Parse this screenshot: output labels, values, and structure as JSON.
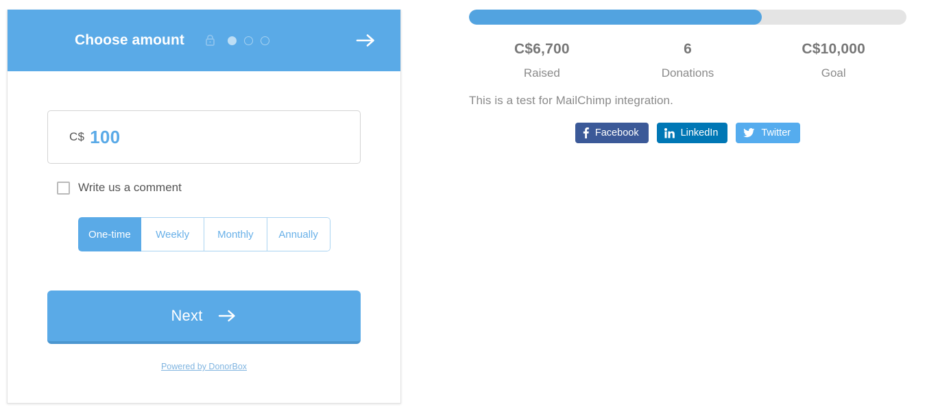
{
  "donation_form": {
    "header": {
      "title": "Choose amount",
      "lock_icon": "lock-icon",
      "next_arrow_icon": "arrow-right-icon",
      "steps": [
        {
          "state": "active"
        },
        {
          "state": "inactive"
        },
        {
          "state": "inactive"
        }
      ]
    },
    "amount": {
      "currency": "C$",
      "value": "100"
    },
    "comment": {
      "label": "Write us a comment",
      "checked": false
    },
    "frequency": {
      "selected": "One-time",
      "options": [
        {
          "label": "One-time",
          "active": true
        },
        {
          "label": "Weekly",
          "active": false
        },
        {
          "label": "Monthly",
          "active": false
        },
        {
          "label": "Annually",
          "active": false
        }
      ]
    },
    "next_button": {
      "label": "Next",
      "icon": "arrow-right-icon"
    },
    "footer": {
      "powered_by": "Powered by DonorBox"
    }
  },
  "campaign": {
    "progress": {
      "percent": 67,
      "fill_color": "#52a3e0",
      "track_color": "#e4e4e4"
    },
    "stats": [
      {
        "value": "C$6,700",
        "label": "Raised"
      },
      {
        "value": "6",
        "label": "Donations"
      },
      {
        "value": "C$10,000",
        "label": "Goal"
      }
    ],
    "description": "This is a test for MailChimp integration.",
    "share": [
      {
        "label": "Facebook",
        "icon": "facebook-icon",
        "color": "#3b5998"
      },
      {
        "label": "LinkedIn",
        "icon": "linkedin-icon",
        "color": "#0077b5"
      },
      {
        "label": "Twitter",
        "icon": "twitter-icon",
        "color": "#55acee"
      }
    ]
  },
  "theme": {
    "accent": "#5aaae7",
    "accent_dark": "#4b96cf",
    "text_gray": "#777777"
  }
}
